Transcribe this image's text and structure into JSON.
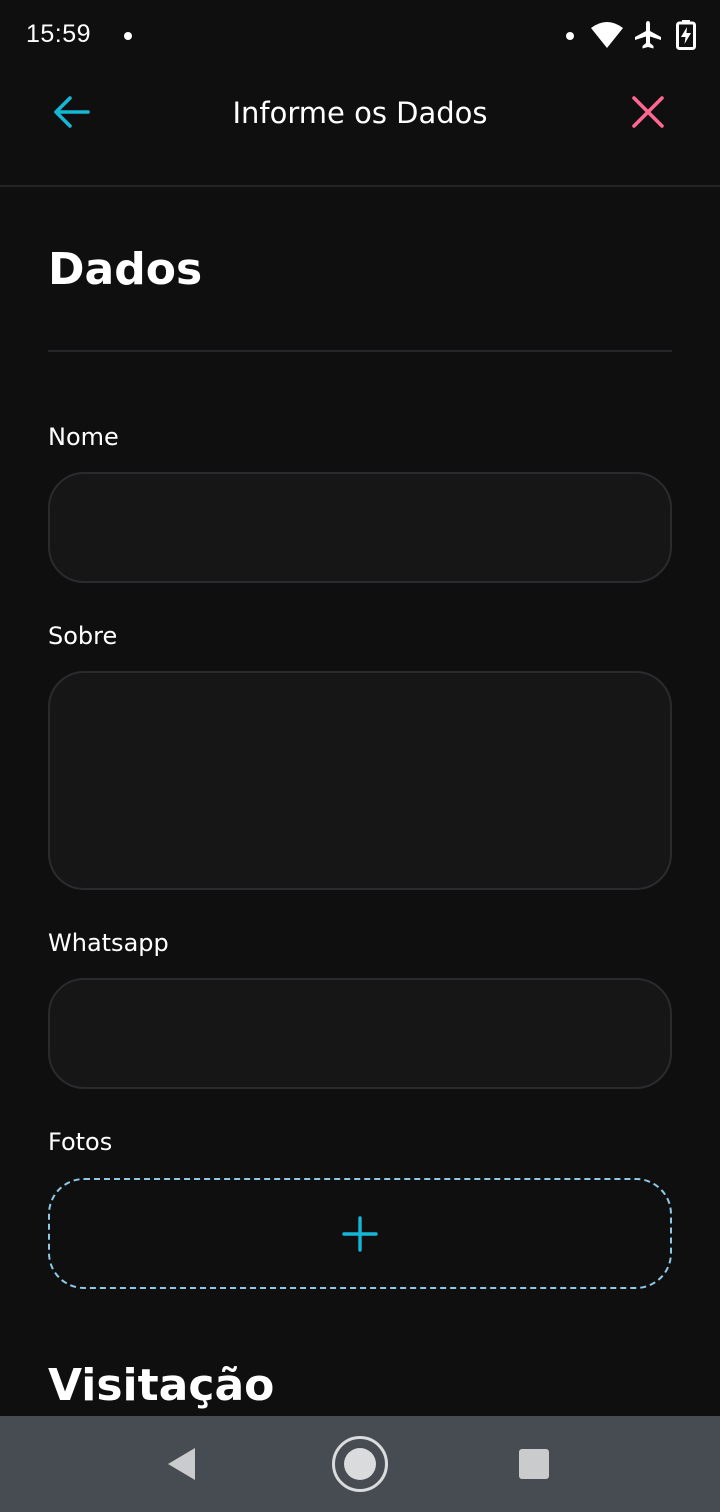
{
  "status_bar": {
    "time": "15:59",
    "icons": [
      "notification-dot-icon",
      "wifi-icon",
      "airplane-mode-icon",
      "battery-charging-icon"
    ]
  },
  "header": {
    "title": "Informe os Dados",
    "back_icon": "arrow-left-icon",
    "close_icon": "close-icon"
  },
  "sections": {
    "dados_title": "Dados",
    "visitacao_title": "Visitação"
  },
  "form": {
    "nome": {
      "label": "Nome",
      "value": "",
      "placeholder": ""
    },
    "sobre": {
      "label": "Sobre",
      "value": "",
      "placeholder": ""
    },
    "whatsapp": {
      "label": "Whatsapp",
      "value": "",
      "placeholder": ""
    },
    "fotos": {
      "label": "Fotos",
      "add_icon": "plus-icon"
    }
  },
  "nav_bar": {
    "icons": [
      "back-triangle-icon",
      "home-circle-icon",
      "recents-square-icon"
    ]
  },
  "colors": {
    "background": "#0f0f10",
    "accent_blue": "#15b6d6",
    "close_pink": "#ff6690",
    "field_background": "#161617",
    "field_border": "#2a2b2e",
    "dashed_border": "#8fc9e6",
    "nav_bar": "#464c52"
  }
}
